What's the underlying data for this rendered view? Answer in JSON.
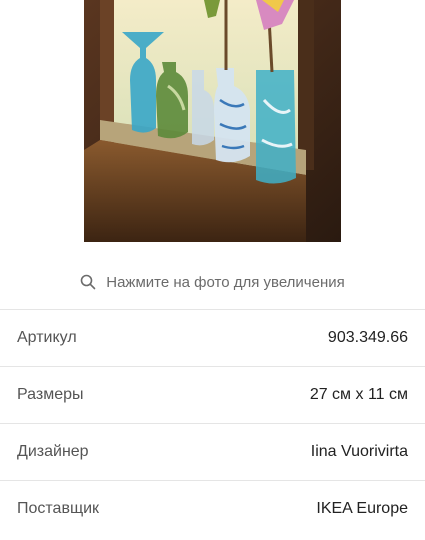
{
  "product_image": {
    "alt_icon": "vases-photo"
  },
  "zoom_hint": {
    "text": "Нажмите на фото для увеличения",
    "icon": "search-icon"
  },
  "specs": [
    {
      "label": "Артикул",
      "value": "903.349.66"
    },
    {
      "label": "Размеры",
      "value": "27 см x 11 см"
    },
    {
      "label": "Дизайнер",
      "value": "Iina Vuorivirta"
    },
    {
      "label": "Поставщик",
      "value": "IKEA Europe"
    }
  ],
  "colors": {
    "divider": "#e5e5e5",
    "label": "#555555",
    "value": "#222222",
    "hint": "#6b6b6b"
  }
}
